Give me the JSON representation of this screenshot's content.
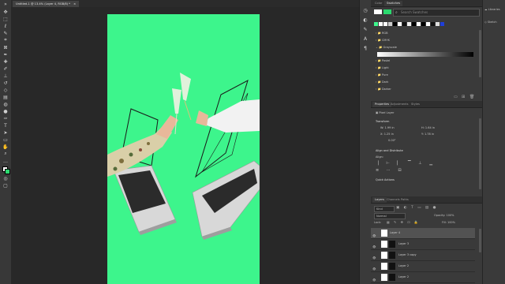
{
  "document": {
    "tab_title": "Untitled-1 @ 13.4% (Layer 4, RGB/8) *"
  },
  "panels": {
    "top_tabs": [
      "Color",
      "Swatches"
    ],
    "search_placeholder": "Search Swatches",
    "swatch_groups": [
      "RGB",
      "CMYK",
      "Grayscale",
      "Pastel",
      "Light",
      "Pure",
      "Dark",
      "Darker"
    ],
    "properties_tabs": [
      "Properties",
      "Adjustments",
      "Styles"
    ],
    "pixel_layer": "Pixel Layer",
    "transform": {
      "title": "Transform",
      "w": "W: 1.99 in",
      "h": "H: 1.64 in",
      "x": "X: 1.25 in",
      "y": "Y: 1.78 in",
      "angle": "0.00°"
    },
    "align_title": "Align and Distribute",
    "align_label": "Align:",
    "quick_actions": "Quick Actions",
    "layers_tabs": [
      "Layers",
      "Channels",
      "Paths"
    ],
    "kind": "Kind",
    "blend_mode": "Normal",
    "opacity": "Opacity: 100%",
    "lock_label": "Lock:",
    "fill": "Fill: 100%",
    "layers": [
      {
        "name": "Layer 4",
        "selected": true,
        "mask": false
      },
      {
        "name": "Layer 3",
        "selected": false,
        "mask": true
      },
      {
        "name": "Layer 3 copy",
        "selected": false,
        "mask": true
      },
      {
        "name": "Layer 2",
        "selected": false,
        "mask": true
      },
      {
        "name": "Layer 2",
        "selected": false,
        "mask": true
      }
    ]
  },
  "libstrip": {
    "libraries": "Libraries",
    "sketch": "Sketch"
  },
  "colors": {
    "artboard": "#3df58c",
    "fg": "#ffffff",
    "bg": "#2bd96e",
    "accent": "#2d7fdc"
  }
}
